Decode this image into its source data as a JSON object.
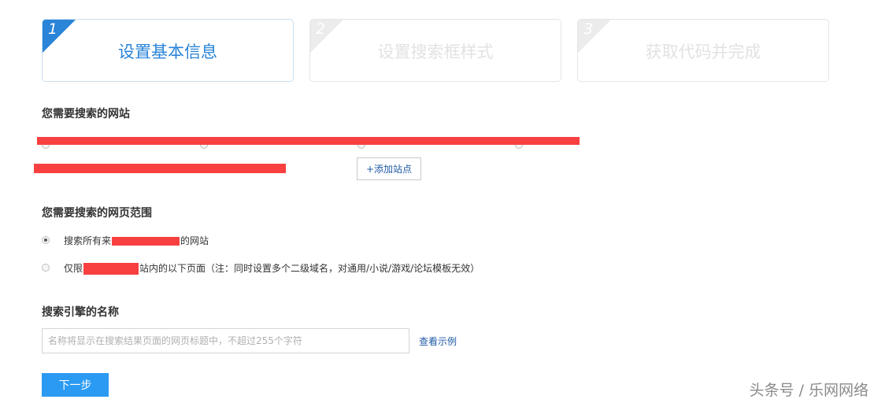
{
  "steps": [
    {
      "num": "1",
      "label": "设置基本信息"
    },
    {
      "num": "2",
      "label": "设置搜索框样式"
    },
    {
      "num": "3",
      "label": "获取代码并完成"
    }
  ],
  "site_section": {
    "title": "您需要搜索的网站",
    "add_site_label": "+添加站点"
  },
  "scope_section": {
    "title": "您需要搜索的网页范围",
    "option_all": {
      "before": "搜索所有来",
      "after": "的网站"
    },
    "option_limited": {
      "before": "仅限",
      "after": "站内的以下页面（注：同时设置多个二级域名，对通用/小说/游戏/论坛模板无效）"
    }
  },
  "name_section": {
    "title": "搜索引擎的名称",
    "placeholder": "名称将显示在搜索结果页面的网页标题中，不超过255个字符",
    "example_link": "查看示例"
  },
  "next_button": "下一步",
  "watermark": "头条号 / 乐网网络",
  "colors": {
    "accent": "#2a84d8",
    "button": "#2b9af3",
    "redaction": "#f84040",
    "link": "#1f5aa5"
  }
}
